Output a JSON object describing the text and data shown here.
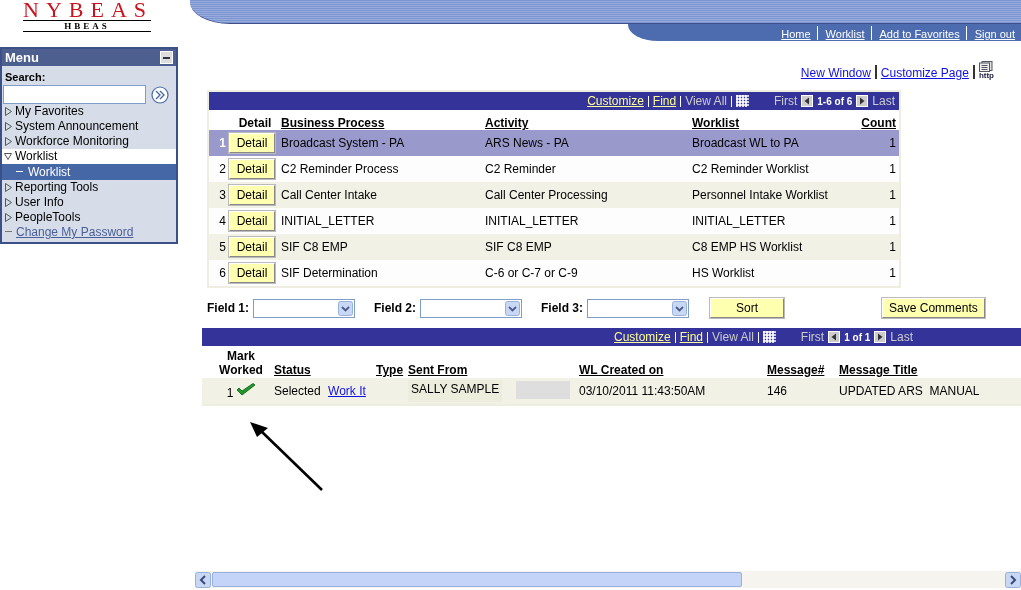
{
  "logo": {
    "title": "NYBEAS",
    "subtitle": "HBEAS"
  },
  "nav_links": [
    "Home",
    "Worklist",
    "Add to Favorites",
    "Sign out"
  ],
  "sidebar": {
    "title": "Menu",
    "search_label": "Search:",
    "items": [
      {
        "kind": "folder",
        "label": "My Favorites",
        "expanded": false,
        "selected": false
      },
      {
        "kind": "folder",
        "label": "System Announcement",
        "expanded": false,
        "selected": false
      },
      {
        "kind": "folder",
        "label": "Workforce Monitoring",
        "expanded": false,
        "selected": false
      },
      {
        "kind": "folder",
        "label": "Worklist",
        "expanded": true,
        "selected": false,
        "children": [
          {
            "kind": "leaf",
            "label": "Worklist",
            "selected": true
          }
        ]
      },
      {
        "kind": "folder",
        "label": "Reporting Tools",
        "expanded": false,
        "selected": false
      },
      {
        "kind": "folder",
        "label": "User Info",
        "expanded": false,
        "selected": false
      },
      {
        "kind": "folder",
        "label": "PeopleTools",
        "expanded": false,
        "selected": false
      },
      {
        "kind": "link",
        "label": "Change My Password",
        "selected": false
      }
    ]
  },
  "page_links": [
    "New Window",
    "Customize Page"
  ],
  "http_icon_label": "http",
  "worklist_grid": {
    "toolbar": {
      "customize": "Customize",
      "find": "Find",
      "view_all": "View All",
      "first": "First",
      "range": "1-6 of 6",
      "last": "Last"
    },
    "columns": [
      "Detail",
      "Business Process",
      "Activity",
      "Worklist",
      "Count"
    ],
    "rows": [
      {
        "number": "1",
        "button": "Detail",
        "business_process": "Broadcast System - PA",
        "activity": "ARS News - PA",
        "worklist": "Broadcast WL to PA",
        "count": "1",
        "selected": true
      },
      {
        "number": "2",
        "button": "Detail",
        "business_process": "C2 Reminder Process",
        "activity": "C2 Reminder",
        "worklist": "C2 Reminder Worklist",
        "count": "1",
        "selected": false
      },
      {
        "number": "3",
        "button": "Detail",
        "business_process": "Call Center Intake",
        "activity": "Call Center Processing",
        "worklist": "Personnel Intake Worklist",
        "count": "1",
        "selected": false
      },
      {
        "number": "4",
        "button": "Detail",
        "business_process": "INITIAL_LETTER",
        "activity": "INITIAL_LETTER",
        "worklist": "INITIAL_LETTER",
        "count": "1",
        "selected": false
      },
      {
        "number": "5",
        "button": "Detail",
        "business_process": "SIF C8 EMP",
        "activity": "SIF C8 EMP",
        "worklist": "C8 EMP HS Worklist",
        "count": "1",
        "selected": false
      },
      {
        "number": "6",
        "button": "Detail",
        "business_process": "SIF Determination",
        "activity": "C-6 or C-7 or C-9",
        "worklist": "HS Worklist",
        "count": "1",
        "selected": false
      }
    ]
  },
  "sort_fields": [
    {
      "label": "Field 1:"
    },
    {
      "label": "Field 2:"
    },
    {
      "label": "Field 3:"
    }
  ],
  "sort_button": "Sort",
  "save_button": "Save Comments",
  "item_grid": {
    "toolbar": {
      "customize": "Customize",
      "find": "Find",
      "view_all": "View All",
      "first": "First",
      "range": "1 of 1",
      "last": "Last"
    },
    "columns": [
      "Mark Worked",
      "Status",
      "Type",
      "Sent From",
      "WL Created on",
      "Message#",
      "Message Title"
    ],
    "rows": [
      {
        "number": "1",
        "mark_worked": true,
        "status": "Selected",
        "action": "Work It",
        "sent_from": "SALLY SAMPLE",
        "created": "03/10/2011 11:43:50AM",
        "message_number": "146",
        "message_title": "UPDATED ARS  MANUAL"
      }
    ]
  }
}
